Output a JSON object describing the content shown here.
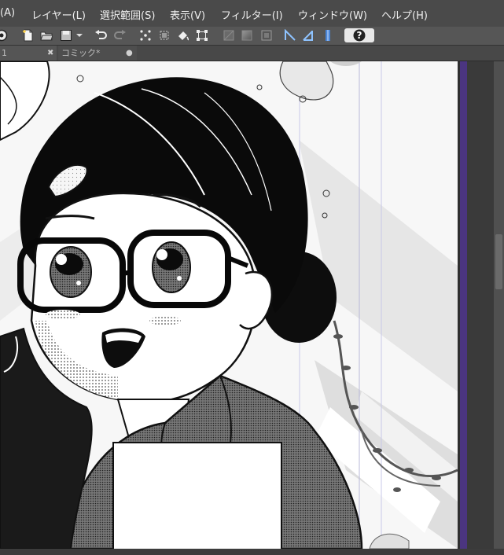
{
  "menu": {
    "items": [
      {
        "id": "edit",
        "label": "(A)"
      },
      {
        "id": "layer",
        "label": "レイヤー(L)"
      },
      {
        "id": "selection",
        "label": "選択範囲(S)"
      },
      {
        "id": "view",
        "label": "表示(V)"
      },
      {
        "id": "filter",
        "label": "フィルター(I)"
      },
      {
        "id": "window",
        "label": "ウィンドウ(W)"
      },
      {
        "id": "help",
        "label": "ヘルプ(H)"
      }
    ]
  },
  "toolbar": {
    "help_label": "?"
  },
  "tabs": [
    {
      "label": "1",
      "close": "✖"
    },
    {
      "label": "コミック*",
      "close": "●"
    }
  ],
  "colors": {
    "menubar": "#4a4a4a",
    "toolbar": "#565656",
    "page": "#fafafa",
    "accent_purple": "#4b3580"
  }
}
